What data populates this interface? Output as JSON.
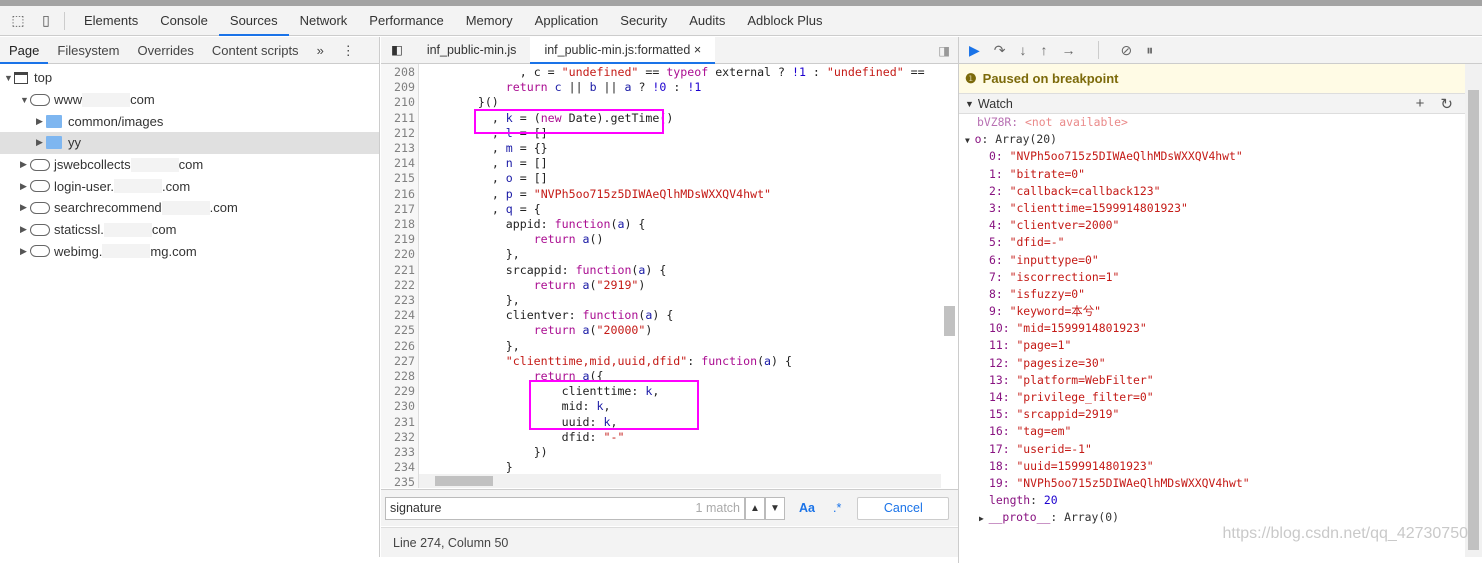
{
  "colors": {
    "accent": "#1a73e8",
    "highlight_box": "#ff00ff",
    "paused_bg": "#fffbe5"
  },
  "main_tabs": [
    "Elements",
    "Console",
    "Sources",
    "Network",
    "Performance",
    "Memory",
    "Application",
    "Security",
    "Audits",
    "Adblock Plus"
  ],
  "active_main_tab": "Sources",
  "navigator": {
    "tabs": [
      "Page",
      "Filesystem",
      "Overrides",
      "Content scripts"
    ],
    "more": "»",
    "tree": [
      {
        "label": "top",
        "type": "frame",
        "level": 0,
        "open": true
      },
      {
        "label": "www",
        "suffix": "com",
        "type": "cloud",
        "level": 1,
        "open": true
      },
      {
        "label": "common/images",
        "type": "folder",
        "level": 2
      },
      {
        "label": "yy",
        "type": "folder",
        "level": 2,
        "selected": true
      },
      {
        "label": "jswebcollects",
        "suffix": "com",
        "type": "cloud",
        "level": 1
      },
      {
        "label": "login-user.",
        "suffix": ".com",
        "type": "cloud",
        "level": 1
      },
      {
        "label": "searchrecommend",
        "suffix": ".com",
        "type": "cloud",
        "level": 1
      },
      {
        "label": "staticssl.",
        "suffix": "com",
        "type": "cloud",
        "level": 1
      },
      {
        "label": "webimg.",
        "suffix": "mg.com",
        "type": "cloud",
        "level": 1
      }
    ]
  },
  "editor": {
    "tabs": [
      "inf_public-min.js",
      "inf_public-min.js:formatted"
    ],
    "close": "×",
    "lines": [
      [
        208,
        [
          [
            14,
            "p",
            ", c = "
          ],
          [
            "s",
            "\"undefined\""
          ],
          [
            "p",
            " == "
          ],
          [
            "k",
            "typeof"
          ],
          [
            "p",
            " external ? "
          ],
          [
            "n",
            "!1"
          ],
          [
            "p",
            " : "
          ],
          [
            "s",
            "\"undefined\""
          ],
          [
            "p",
            " =="
          ]
        ]
      ],
      [
        209,
        [
          [
            12,
            "k",
            "return"
          ],
          [
            "v",
            " c "
          ],
          [
            "p",
            "|| "
          ],
          [
            "v",
            "b "
          ],
          [
            "p",
            "|| "
          ],
          [
            "v",
            "a "
          ],
          [
            "p",
            "? "
          ],
          [
            "n",
            "!0"
          ],
          [
            "p",
            " : "
          ],
          [
            "n",
            "!1"
          ]
        ]
      ],
      [
        210,
        [
          [
            8,
            "p",
            "}()"
          ]
        ]
      ],
      [
        211,
        [
          [
            10,
            "p",
            ", "
          ],
          [
            "v",
            "k"
          ],
          [
            "p",
            " = ("
          ],
          [
            "k",
            "new"
          ],
          [
            "p",
            " Date).getTime()"
          ]
        ]
      ],
      [
        212,
        [
          [
            10,
            "p",
            ", "
          ],
          [
            "v",
            "l"
          ],
          [
            "p",
            " = []"
          ]
        ]
      ],
      [
        213,
        [
          [
            10,
            "p",
            ", "
          ],
          [
            "v",
            "m"
          ],
          [
            "p",
            " = {}"
          ]
        ]
      ],
      [
        214,
        [
          [
            10,
            "p",
            ", "
          ],
          [
            "v",
            "n"
          ],
          [
            "p",
            " = []"
          ]
        ]
      ],
      [
        215,
        [
          [
            10,
            "p",
            ", "
          ],
          [
            "v",
            "o"
          ],
          [
            "p",
            " = []"
          ]
        ]
      ],
      [
        216,
        [
          [
            10,
            "p",
            ", "
          ],
          [
            "v",
            "p"
          ],
          [
            "p",
            " = "
          ],
          [
            "s",
            "\"NVPh5oo715z5DIWAeQlhMDsWXXQV4hwt\""
          ]
        ]
      ],
      [
        217,
        [
          [
            10,
            "p",
            ", "
          ],
          [
            "v",
            "q"
          ],
          [
            "p",
            " = {"
          ]
        ]
      ],
      [
        218,
        [
          [
            12,
            "p",
            "appid: "
          ],
          [
            "k",
            "function"
          ],
          [
            "p",
            "("
          ],
          [
            "v",
            "a"
          ],
          [
            "p",
            ") {"
          ]
        ]
      ],
      [
        219,
        [
          [
            16,
            "k",
            "return"
          ],
          [
            "v",
            " a"
          ],
          [
            "p",
            "()"
          ]
        ]
      ],
      [
        220,
        [
          [
            12,
            "p",
            "},"
          ]
        ]
      ],
      [
        221,
        [
          [
            12,
            "p",
            "srcappid: "
          ],
          [
            "k",
            "function"
          ],
          [
            "p",
            "("
          ],
          [
            "v",
            "a"
          ],
          [
            "p",
            ") {"
          ]
        ]
      ],
      [
        222,
        [
          [
            16,
            "k",
            "return"
          ],
          [
            "v",
            " a"
          ],
          [
            "p",
            "("
          ],
          [
            "s",
            "\"2919\""
          ],
          [
            "p",
            ")"
          ]
        ]
      ],
      [
        223,
        [
          [
            12,
            "p",
            "},"
          ]
        ]
      ],
      [
        224,
        [
          [
            12,
            "p",
            "clientver: "
          ],
          [
            "k",
            "function"
          ],
          [
            "p",
            "("
          ],
          [
            "v",
            "a"
          ],
          [
            "p",
            ") {"
          ]
        ]
      ],
      [
        225,
        [
          [
            16,
            "k",
            "return"
          ],
          [
            "v",
            " a"
          ],
          [
            "p",
            "("
          ],
          [
            "s",
            "\"20000\""
          ],
          [
            "p",
            ")"
          ]
        ]
      ],
      [
        226,
        [
          [
            12,
            "p",
            "},"
          ]
        ]
      ],
      [
        227,
        [
          [
            12,
            "s",
            "\"clienttime,mid,uuid,dfid\""
          ],
          [
            "p",
            ": "
          ],
          [
            "k",
            "function"
          ],
          [
            "p",
            "("
          ],
          [
            "v",
            "a"
          ],
          [
            "p",
            ") {"
          ]
        ]
      ],
      [
        228,
        [
          [
            16,
            "k",
            "return"
          ],
          [
            "v",
            " a"
          ],
          [
            "p",
            "({"
          ]
        ]
      ],
      [
        229,
        [
          [
            20,
            "p",
            "clienttime: "
          ],
          [
            "v",
            "k"
          ],
          [
            "p",
            ","
          ]
        ]
      ],
      [
        230,
        [
          [
            20,
            "p",
            "mid: "
          ],
          [
            "v",
            "k"
          ],
          [
            "p",
            ","
          ]
        ]
      ],
      [
        231,
        [
          [
            20,
            "p",
            "uuid: "
          ],
          [
            "v",
            "k"
          ],
          [
            "p",
            ","
          ]
        ]
      ],
      [
        232,
        [
          [
            20,
            "p",
            "dfid: "
          ],
          [
            "s",
            "\"-\""
          ]
        ]
      ],
      [
        233,
        [
          [
            16,
            "p",
            "})"
          ]
        ]
      ],
      [
        234,
        [
          [
            12,
            "p",
            "}"
          ]
        ]
      ],
      [
        235,
        [
          [
            0,
            "p",
            ""
          ]
        ]
      ]
    ]
  },
  "search": {
    "value": "signature",
    "matches": "1 match",
    "case_label": "Aa",
    "regex_label": ".*",
    "cancel": "Cancel"
  },
  "status": "Line 274, Column 50",
  "debugger": {
    "paused": "Paused on breakpoint",
    "watch_title": "Watch",
    "watch_unavail_name": "bVZ8R",
    "watch_unavail_value": "<not available>",
    "array_name": "o",
    "array_summary": "Array(20)",
    "items": [
      "NVPh5oo715z5DIWAeQlhMDsWXXQV4hwt",
      "bitrate=0",
      "callback=callback123",
      "clienttime=1599914801923",
      "clientver=2000",
      "dfid=-",
      "inputtype=0",
      "iscorrection=1",
      "isfuzzy=0",
      "keyword=本兮",
      "mid=1599914801923",
      "page=1",
      "pagesize=30",
      "platform=WebFilter",
      "privilege_filter=0",
      "srcappid=2919",
      "tag=em",
      "userid=-1",
      "uuid=1599914801923",
      "NVPh5oo715z5DIWAeQlhMDsWXXQV4hwt"
    ],
    "length_label": "length",
    "length": "20",
    "proto_label": "__proto__",
    "proto_value": "Array(0)"
  },
  "watermark": "https://blog.csdn.net/qq_42730750"
}
